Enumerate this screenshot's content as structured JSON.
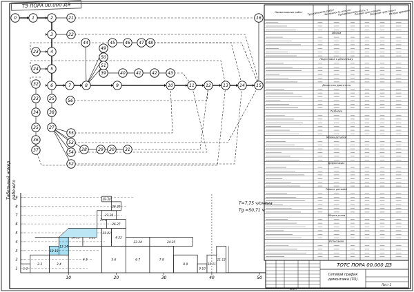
{
  "drawing": {
    "stamp_code_rotated": "ТЭ ПОРА 00.000 ДЭ",
    "side_label_line1": "Табельный номер",
    "side_label_line2": "рабочего",
    "formula_t": "T=7,75 ч/смена",
    "formula_tg": "Tg =50,71 ч",
    "title_block": {
      "designation": "ТОТС ПОРА 00.000 ДЗ",
      "name_line1": "Сетевой график",
      "name_line2": "демонтажа (ТО)",
      "sheet_label": "Лист 1",
      "org": "МГУП"
    }
  },
  "network": {
    "nodes": [
      {
        "id": "0",
        "label": "0"
      },
      {
        "id": "1",
        "label": "1"
      },
      {
        "id": "2",
        "label": "2"
      },
      {
        "id": "3",
        "label": "3"
      },
      {
        "id": "4",
        "label": "4"
      },
      {
        "id": "5",
        "label": "5"
      },
      {
        "id": "6",
        "label": "6"
      },
      {
        "id": "7",
        "label": "7"
      },
      {
        "id": "8",
        "label": "8"
      },
      {
        "id": "9",
        "label": "9"
      },
      {
        "id": "10",
        "label": "10"
      },
      {
        "id": "11",
        "label": "11"
      },
      {
        "id": "12",
        "label": "12"
      },
      {
        "id": "13",
        "label": "13"
      },
      {
        "id": "14",
        "label": "14"
      },
      {
        "id": "15",
        "label": "15"
      },
      {
        "id": "16",
        "label": "16"
      },
      {
        "id": "21",
        "label": "21"
      },
      {
        "id": "22",
        "label": "22"
      },
      {
        "id": "23",
        "label": "23"
      },
      {
        "id": "24",
        "label": "24"
      },
      {
        "id": "25",
        "label": "25"
      },
      {
        "id": "26",
        "label": "26"
      },
      {
        "id": "27",
        "label": "27"
      },
      {
        "id": "28",
        "label": "28"
      },
      {
        "id": "29",
        "label": "29"
      },
      {
        "id": "30",
        "label": "30"
      },
      {
        "id": "31",
        "label": "31"
      },
      {
        "id": "32",
        "label": "32"
      },
      {
        "id": "33",
        "label": "33"
      },
      {
        "id": "34",
        "label": "34"
      },
      {
        "id": "35",
        "label": "35"
      },
      {
        "id": "36",
        "label": "36"
      },
      {
        "id": "37",
        "label": "37"
      },
      {
        "id": "38",
        "label": "38"
      },
      {
        "id": "39",
        "label": "39"
      },
      {
        "id": "40",
        "label": "40"
      },
      {
        "id": "41",
        "label": "41"
      },
      {
        "id": "42",
        "label": "42"
      },
      {
        "id": "43",
        "label": "43"
      },
      {
        "id": "44",
        "label": "44"
      },
      {
        "id": "45",
        "label": "45"
      },
      {
        "id": "46",
        "label": "46"
      },
      {
        "id": "47",
        "label": "47"
      },
      {
        "id": "48",
        "label": "48"
      },
      {
        "id": "49",
        "label": "49"
      },
      {
        "id": "50",
        "label": "50"
      },
      {
        "id": "51",
        "label": "51"
      },
      {
        "id": "52",
        "label": "52"
      },
      {
        "id": "53",
        "label": "53"
      },
      {
        "id": "54",
        "label": "54"
      },
      {
        "id": "55",
        "label": "55"
      },
      {
        "id": "56",
        "label": "56"
      }
    ]
  },
  "gantt": {
    "y_ticks": [
      "1",
      "2",
      "3",
      "4",
      "5",
      "6",
      "7",
      "8",
      "9"
    ],
    "x_ticks": [
      "10",
      "20",
      "30",
      "40",
      "50"
    ],
    "bar_labels": [
      "1-2",
      "2-3",
      "3-4",
      "4-5",
      "5-6",
      "6-7",
      "7-8",
      "8-9",
      "9-10",
      "10-11",
      "11-12",
      "12-13",
      "13-14",
      "14-15",
      "2-21",
      "21-22",
      "4-23",
      "23-24",
      "24-25",
      "25-26",
      "26-27",
      "27-28",
      "28-29",
      "29-30",
      "6-32",
      "32-33",
      "33-34",
      "34-35",
      "35-36",
      "8-37",
      "8-38",
      "39-40",
      "40-41",
      "41-42",
      "8-44"
    ]
  },
  "table": {
    "headers": [
      "Наименование работ",
      "Трудоёмкость работы, чел·ч",
      "Численность исполнителей",
      "Продолжительность, ч",
      "Ранний срок начала",
      "Поздний срок окончания",
      "Резерв времени"
    ],
    "sections": [
      "Сборка",
      "Подготовка к демонтажу",
      "Демонтаж двигателя",
      "Разборка",
      "Мойка деталей",
      "Дефектация",
      "Ремонт деталей",
      "Сборка узлов",
      "Испытания"
    ]
  }
}
